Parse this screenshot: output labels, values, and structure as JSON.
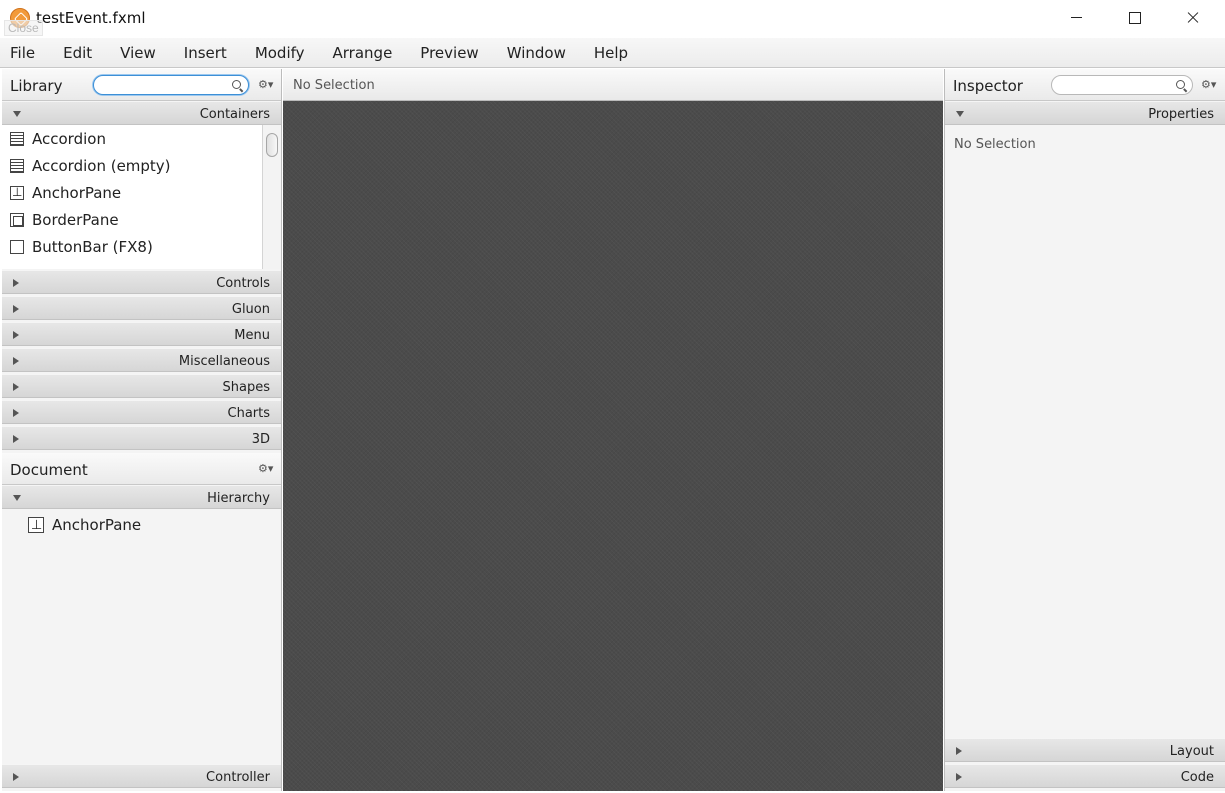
{
  "window": {
    "title": "testEvent.fxml",
    "tooltip": "Close"
  },
  "menu": [
    "File",
    "Edit",
    "View",
    "Insert",
    "Modify",
    "Arrange",
    "Preview",
    "Window",
    "Help"
  ],
  "library": {
    "title": "Library",
    "search_value": "",
    "sections": {
      "containers": "Containers",
      "controls": "Controls",
      "gluon": "Gluon",
      "menu": "Menu",
      "miscellaneous": "Miscellaneous",
      "shapes": "Shapes",
      "charts": "Charts",
      "three_d": "3D"
    },
    "containers": [
      {
        "label": "Accordion",
        "icon": "accordion-icon"
      },
      {
        "label": "Accordion  (empty)",
        "icon": "accordion-icon"
      },
      {
        "label": "AnchorPane",
        "icon": "anchor-pane-icon"
      },
      {
        "label": "BorderPane",
        "icon": "border-pane-icon"
      },
      {
        "label": "ButtonBar  (FX8)",
        "icon": "button-bar-icon"
      }
    ]
  },
  "document": {
    "title": "Document",
    "hierarchy_label": "Hierarchy",
    "root_item": "AnchorPane",
    "controller_label": "Controller"
  },
  "center": {
    "selection_label": "No Selection"
  },
  "inspector": {
    "title": "Inspector",
    "properties_label": "Properties",
    "no_selection": "No Selection",
    "layout_label": "Layout",
    "code_label": "Code"
  },
  "colors": {
    "canvas": "#4b4b4b",
    "focus_ring": "#3d8fd6"
  }
}
